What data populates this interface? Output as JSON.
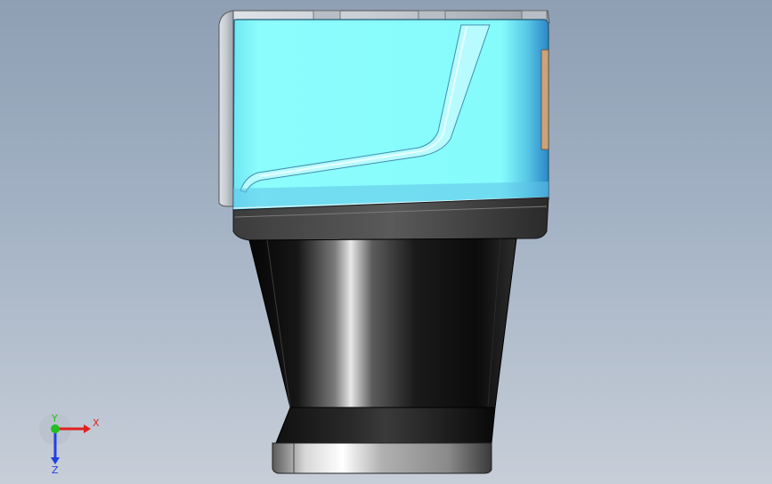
{
  "viewport": {
    "background_top": "#8e9fb4",
    "background_bottom": "#c7ced8"
  },
  "model": {
    "parts": [
      "sensor-housing",
      "mounting-bracket",
      "housing-base",
      "lens-barrel",
      "lens-ring"
    ],
    "colors": {
      "housing": "#86fbfc",
      "bracket": "#c9cdd2",
      "base": "#4a4a4a",
      "lens_barrel": "#101010",
      "lens_ring": "#c0c0c0"
    }
  },
  "triad": {
    "x_label": "X",
    "y_label": "Y",
    "z_label": "Z",
    "x_color": "#e02020",
    "y_color": "#20c020",
    "z_color": "#2040e0"
  }
}
